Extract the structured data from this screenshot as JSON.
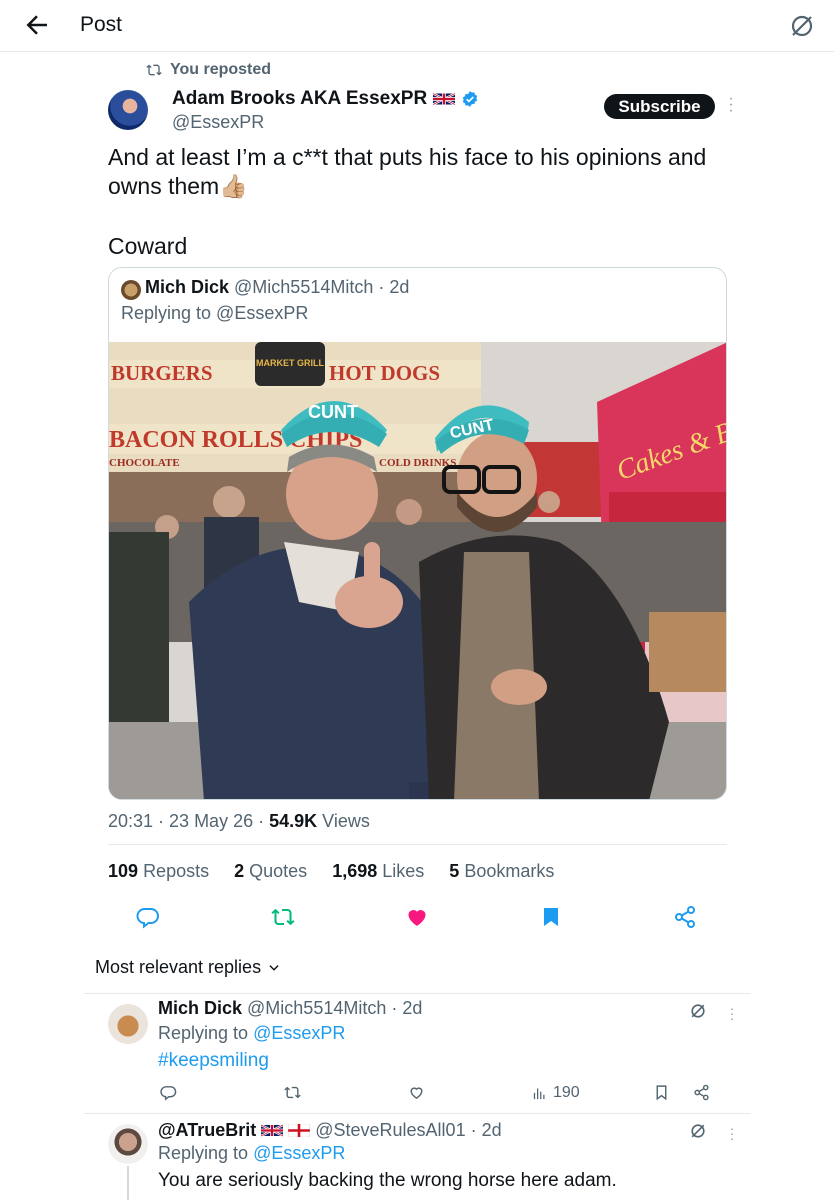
{
  "header": {
    "title": "Post",
    "back_icon": "arrow-left-icon",
    "right_icon": "grok-icon"
  },
  "repost": {
    "label": "You reposted",
    "icon": "repost-icon"
  },
  "author": {
    "name": "Adam Brooks AKA EssexPR",
    "handle": "@EssexPR",
    "subscribe_label": "Subscribe"
  },
  "post": {
    "text": "And at least I’m a c**t that puts his face to his opinions and owns them👍🏼",
    "text2": "Coward",
    "timestamp": "20:31 · 23 May 26 · ",
    "views_count": "54.9K",
    "views_label": " Views"
  },
  "quote": {
    "name": "Mich Dick",
    "handle": "@Mich5514Mitch",
    "time": "· 2d",
    "replying": "Replying to @EssexPR",
    "photo": {
      "sign_left": "BURGERS",
      "sign_right": "HOT DOGS",
      "sign_center": "MARKET GRILL",
      "sign_row2": "BACON ROLLS CHIPS",
      "sign_row3": "CHOCOLATE",
      "sign_row3_right": "COLD DRINKS",
      "hat_text": "CUNT",
      "stall_text": "Cakes & Ba"
    }
  },
  "stats": [
    {
      "count": "109",
      "label": "Reposts"
    },
    {
      "count": "2",
      "label": "Quotes"
    },
    {
      "count": "1,698",
      "label": "Likes"
    },
    {
      "count": "5",
      "label": "Bookmarks"
    }
  ],
  "actions": [
    "reply-icon",
    "repost-icon",
    "like-icon",
    "bookmark-icon",
    "share-icon"
  ],
  "colors": {
    "repost": "#00ba7c",
    "like": "#f91880",
    "bookmark": "#1d9bf0",
    "link": "#1d9bf0"
  },
  "sort": {
    "label": "Most relevant replies"
  },
  "replies": [
    {
      "name": "Mich Dick",
      "handle": "@Mich5514Mitch",
      "time": "· 2d",
      "replying_prefix": "Replying to ",
      "replying_handle": "@EssexPR",
      "body": "#keepsmiling",
      "views": "190"
    },
    {
      "name": "@ATrueBrit",
      "handle": "@SteveRulesAll01",
      "time": "· 2d",
      "replying_prefix": "Replying to ",
      "replying_handle": "@EssexPR",
      "body": "You are seriously backing the wrong horse here adam."
    }
  ]
}
